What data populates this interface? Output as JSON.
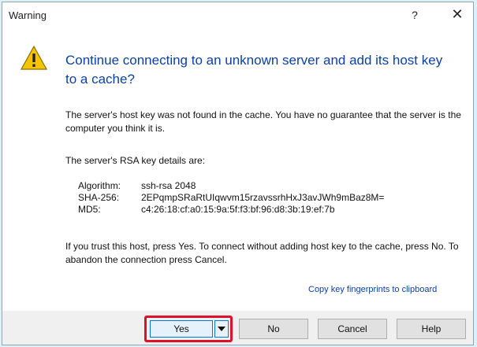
{
  "dialog": {
    "title": "Warning",
    "help_label": "?",
    "close_label": "✕",
    "heading": "Continue connecting to an unknown server and add its host key to a cache?",
    "paragraph_1": "The server's host key was not found in the cache. You have no guarantee that the server is the computer you think it is.",
    "paragraph_2": "The server's RSA key details are:",
    "key_details": [
      {
        "label": "Algorithm:",
        "value": "ssh-rsa 2048"
      },
      {
        "label": "SHA-256:",
        "value": "2EPqmpSRaRtUIqwvm15rzavssrhHxJ3avJWh9mBaz8M="
      },
      {
        "label": "MD5:",
        "value": "c4:26:18:cf:a0:15:9a:5f:f3:bf:96:d8:3b:19:ef:7b"
      }
    ],
    "paragraph_3": "If you trust this host, press Yes. To connect without adding host key to the cache, press No. To abandon the connection press Cancel.",
    "copy_link": "Copy key fingerprints to clipboard"
  },
  "buttons": {
    "yes": "Yes",
    "no": "No",
    "cancel": "Cancel",
    "help": "Help"
  },
  "icons": {
    "warning": "warning-icon",
    "dropdown": "chevron-down-icon"
  },
  "colors": {
    "heading": "#0b3fa6",
    "highlight": "#e0102a",
    "warning_fill": "#f5c400"
  }
}
